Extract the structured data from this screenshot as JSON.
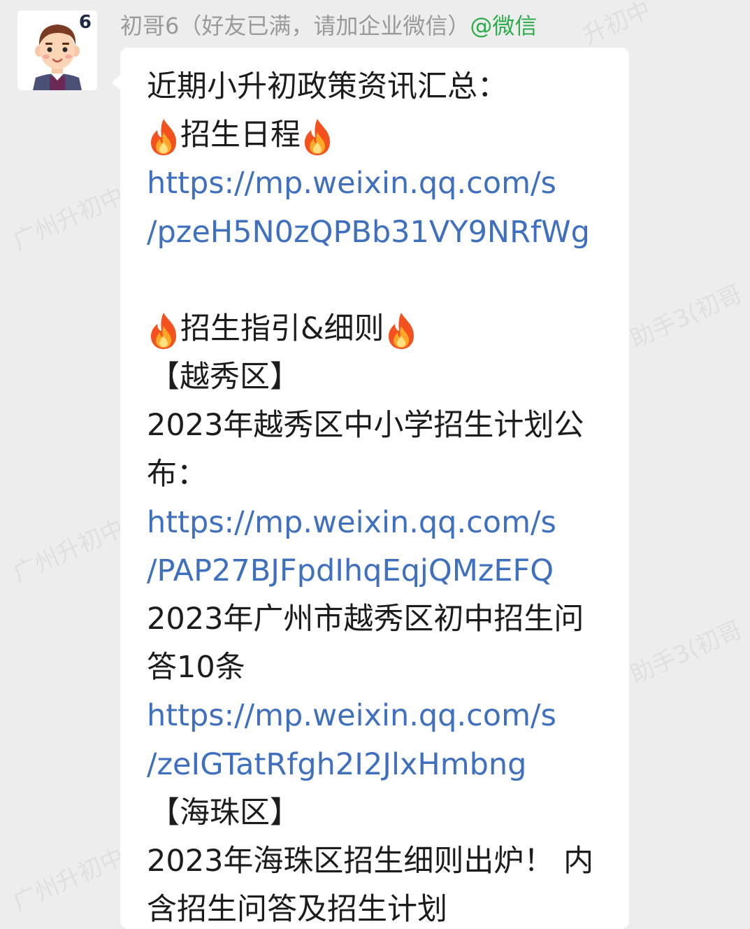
{
  "chat": {
    "sender_name": "初哥6（好友已满，请加企业微信）",
    "sender_tag": "@微信",
    "avatar_badge": "6"
  },
  "watermark": {
    "left_text": "广州升初中",
    "right_text": "助手3(初哥",
    "top_text": "升初中"
  },
  "message": {
    "lines": [
      "近期小升初政策资讯汇总：",
      "招生日程",
      "https://mp.weixin.qq.com/s",
      "/pzeH5N0zQPBb31VY9NRfWg",
      "",
      "招生指引&细则",
      "【越秀区】",
      "2023年越秀区中小学招生计划公",
      "布：",
      "https://mp.weixin.qq.com/s",
      "/PAP27BJFpdIhqEqjQMzEFQ",
      "2023年广州市越秀区初中招生问",
      "答10条",
      "https://mp.weixin.qq.com/s",
      "/zeIGTatRfgh2I2JlxHmbng",
      "【海珠区】",
      "2023年海珠区招生细则出炉！ 内",
      "含招生问答及招生计划"
    ]
  },
  "icons": {
    "flame": "fire-emoji-icon",
    "avatar": "cartoon-boy-avatar-icon"
  },
  "colors": {
    "background": "#ededed",
    "bubble": "#ffffff",
    "link": "#3f6fbf",
    "sender_name": "#9a9a9a",
    "sender_tag": "#2aad4a"
  }
}
